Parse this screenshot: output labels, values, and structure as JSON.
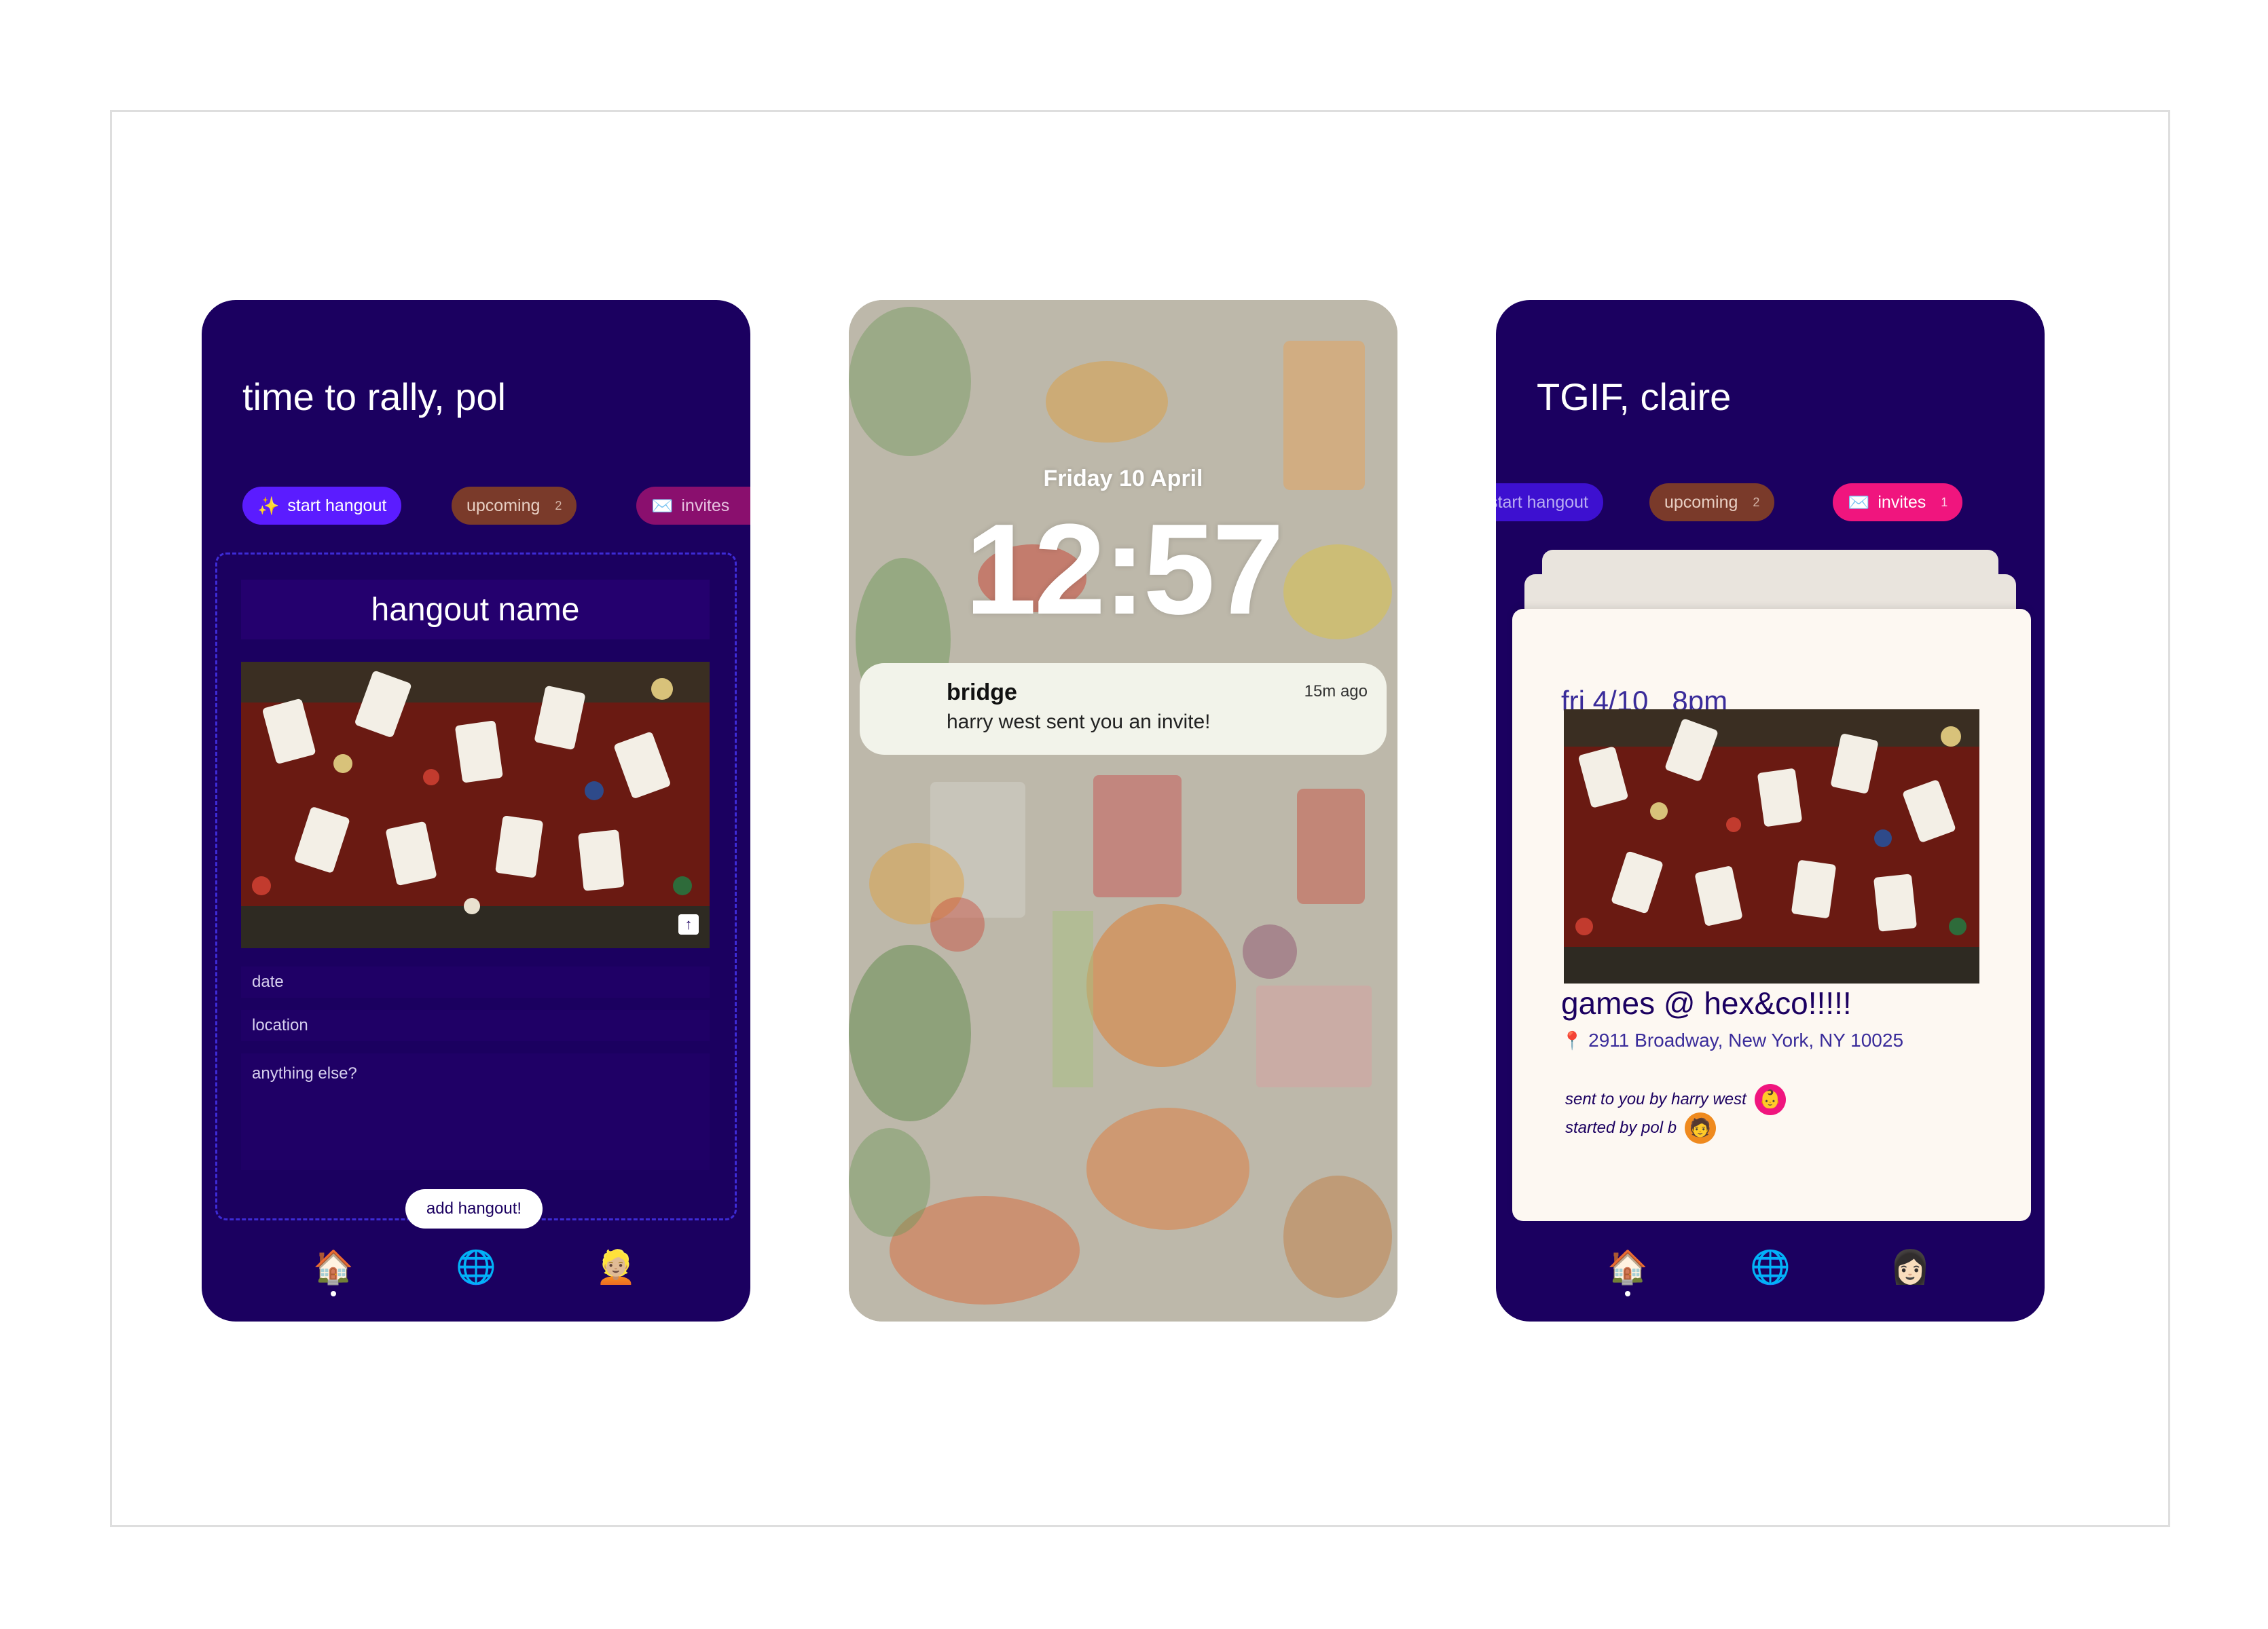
{
  "left_phone": {
    "greeting": "time to rally, pol",
    "tabs": [
      {
        "icon": "✨",
        "label": "start hangout",
        "badge": "",
        "color": "#5b1cff"
      },
      {
        "icon": "",
        "label": "upcoming",
        "badge": "2",
        "color": "#7a3a2a"
      },
      {
        "icon": "✉️",
        "label": "invites",
        "badge": "",
        "color": "#8a0f6e"
      }
    ],
    "form": {
      "name_placeholder": "hangout name",
      "date_placeholder": "date",
      "location_placeholder": "location",
      "notes_placeholder": "anything else?",
      "submit_label": "add hangout!"
    },
    "upload_icon": "↑",
    "nav": [
      "🏠",
      "🌐",
      "👱🏼"
    ]
  },
  "lock_screen": {
    "date": "Friday 10 April",
    "time": "12:57",
    "notification": {
      "app": "bridge",
      "message": "harry west sent you an invite!",
      "time": "15m ago"
    }
  },
  "right_phone": {
    "greeting": "TGIF, claire",
    "tabs": [
      {
        "icon": "",
        "label": "start hangout",
        "badge": "",
        "color": "#3d10d0"
      },
      {
        "icon": "",
        "label": "upcoming",
        "badge": "2",
        "color": "#7a3a2a"
      },
      {
        "icon": "✉️",
        "label": "invites",
        "badge": "1",
        "color": "#f0157e"
      }
    ],
    "card": {
      "datetime": "fri 4/10   8pm",
      "title": "games @ hex&co!!!!!",
      "pin_icon": "📍",
      "address": "2911 Broadway, New York, NY 10025",
      "sent_by": "sent to you by harry west",
      "started_by": "started by pol b",
      "sent_avatar": "👶",
      "started_avatar": "🧑"
    },
    "nav": [
      "🏠",
      "🌐",
      "👩🏻"
    ]
  },
  "colors": {
    "app_bg": "#1b0060",
    "accent_purple": "#5b1cff",
    "accent_pink": "#f0157e",
    "upcoming_brown": "#7a3a2a",
    "card_cream": "#fdf8f2"
  },
  "icons": [
    "sparkles-icon",
    "envelope-icon",
    "upload-icon",
    "house-icon",
    "globe-icon",
    "avatar-icon",
    "pin-icon"
  ]
}
